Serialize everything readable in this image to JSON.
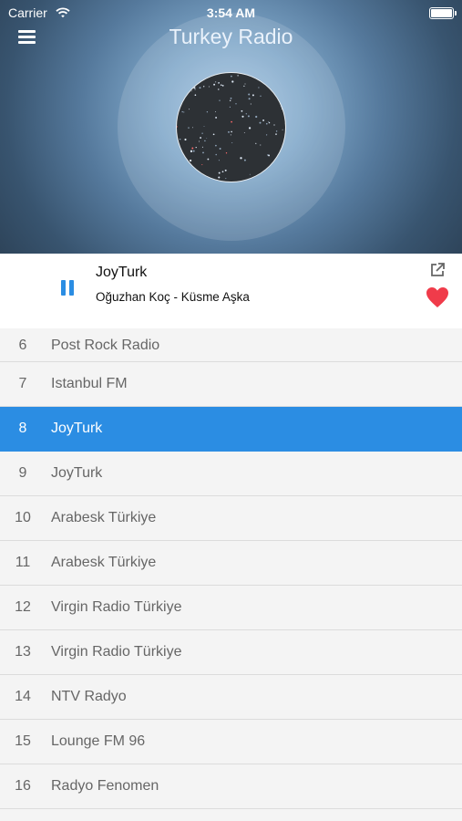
{
  "status_bar": {
    "carrier": "Carrier",
    "time": "3:54 AM"
  },
  "header": {
    "title": "Turkey Radio"
  },
  "now_playing": {
    "station": "JoyTurk",
    "track": "Oğuzhan Koç - Küsme Aşka"
  },
  "colors": {
    "accent": "#2b8de3",
    "heart": "#f03b4a",
    "list_background": "#f4f4f4"
  },
  "icons": {
    "menu": "hamburger-icon",
    "play_state": "pause-icon",
    "share": "external-link-icon",
    "favorite": "heart-icon",
    "wifi": "wifi-icon",
    "battery": "battery-icon"
  },
  "stations": [
    {
      "num": "6",
      "name": "Post Rock Radio",
      "active": false
    },
    {
      "num": "7",
      "name": "Istanbul FM",
      "active": false
    },
    {
      "num": "8",
      "name": "JoyTurk",
      "active": true
    },
    {
      "num": "9",
      "name": "JoyTurk",
      "active": false
    },
    {
      "num": "10",
      "name": "Arabesk Türkiye",
      "active": false
    },
    {
      "num": "11",
      "name": "Arabesk Türkiye",
      "active": false
    },
    {
      "num": "12",
      "name": "Virgin Radio Türkiye",
      "active": false
    },
    {
      "num": "13",
      "name": "Virgin Radio Türkiye",
      "active": false
    },
    {
      "num": "14",
      "name": "NTV Radyo",
      "active": false
    },
    {
      "num": "15",
      "name": "Lounge FM 96",
      "active": false
    },
    {
      "num": "16",
      "name": "Radyo Fenomen",
      "active": false
    }
  ]
}
